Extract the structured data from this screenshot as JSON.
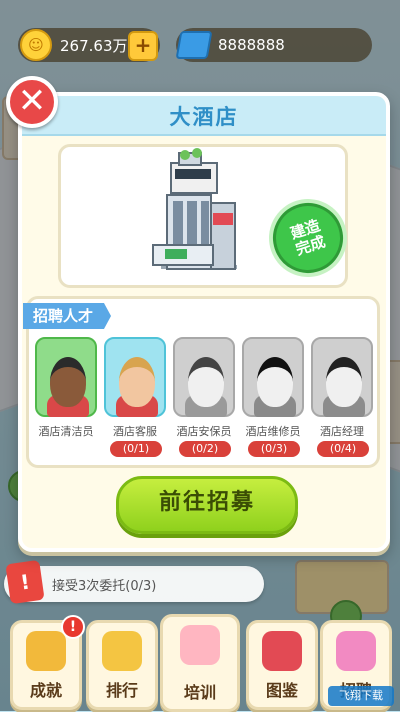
{
  "currency": {
    "coins": "267.63万",
    "gems": "8888888"
  },
  "modal": {
    "title": "大酒店",
    "badge_text": "建造\n完成",
    "talent_section_label": "招聘人才",
    "staff": [
      {
        "name": "酒店清洁员",
        "count": "",
        "color": "#8fdc8a",
        "locked": false
      },
      {
        "name": "酒店客服",
        "count": "(0/1)",
        "color": "#9fe3f0",
        "locked": false
      },
      {
        "name": "酒店安保员",
        "count": "(0/2)",
        "color": "#cfcfcf",
        "locked": true
      },
      {
        "name": "酒店维修员",
        "count": "(0/3)",
        "color": "#cfcfcf",
        "locked": true
      },
      {
        "name": "酒店经理",
        "count": "(0/4)",
        "color": "#cfcfcf",
        "locked": true
      }
    ],
    "recruit_button": "前往招募"
  },
  "task": {
    "text": "接受3次委托(0/3)",
    "icon": "!"
  },
  "bottom_nav": [
    {
      "label": "成就",
      "icon": "trophy-icon",
      "badge": "!"
    },
    {
      "label": "排行",
      "icon": "crown-icon",
      "badge": ""
    },
    {
      "label": "培训",
      "icon": "trainees-icon",
      "badge": ""
    },
    {
      "label": "图鉴",
      "icon": "book-icon",
      "badge": ""
    },
    {
      "label": "招聘",
      "icon": "gift-icon",
      "badge": ""
    }
  ],
  "watermark": "飞翔下载"
}
